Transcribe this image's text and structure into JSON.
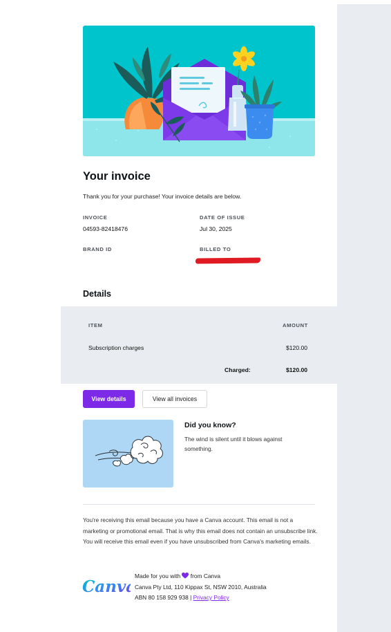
{
  "invoice": {
    "title": "Your invoice",
    "intro": "Thank you for your purchase! Your invoice details are below.",
    "invoice_label": "INVOICE",
    "invoice_number": "04593-82418476",
    "date_label": "DATE OF ISSUE",
    "date_value": "Jul 30, 2025",
    "brand_label": "BRAND ID",
    "billed_label": "BILLED TO"
  },
  "details": {
    "heading": "Details",
    "col_item": "ITEM",
    "col_amount": "AMOUNT",
    "row_item": "Subscription charges",
    "row_amount": "$120.00",
    "charged_label": "Charged:",
    "charged_amount": "$120.00"
  },
  "actions": {
    "view_details": "View details",
    "view_all": "View all invoices"
  },
  "did_you_know": {
    "title": "Did you know?",
    "text": "The wind is silent until it blows against something."
  },
  "footer": {
    "notice": "You're receiving this email because you have a Canva account. This email is not a marketing or promotional email. That is why this email does not contain an unsubscribe link. You will receive this email even if you have unsubscribed from Canva's marketing emails.",
    "made_for_prefix": "Made for you with",
    "made_for_suffix": "from Canva",
    "address": "Canva Pty Ltd, 110 Kippax St, NSW 2010, Australia",
    "abn": "ABN 80 158 929 938 |",
    "privacy_link": "Privacy Policy",
    "logo_text": "Canva"
  },
  "colors": {
    "brand_purple": "#7d2ae8",
    "hero_teal": "#00c4cc",
    "table_band": "#e9edf1",
    "redaction": "#e01a22"
  }
}
